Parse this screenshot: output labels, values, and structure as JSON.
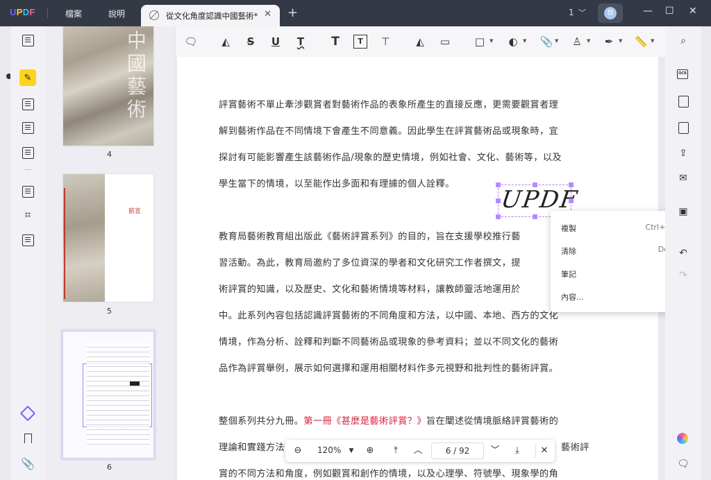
{
  "app": {
    "logo": "UPDF"
  },
  "menu": {
    "file": "檔案",
    "help": "說明"
  },
  "tab": {
    "title": "從文化角度認識中國藝術*",
    "close": "✕",
    "add": "+"
  },
  "window": {
    "page_selector": "1",
    "chevron": "⌄",
    "avatar_initial": "台"
  },
  "thumbnails": [
    {
      "page": "4"
    },
    {
      "page": "5",
      "heading": "前言"
    },
    {
      "page": "6"
    }
  ],
  "thumb4": {
    "title_chars": "中國藝術"
  },
  "document": {
    "lines": [
      "評賞藝術不單止牽涉觀賞者對藝術作品的表象所產生的直接反應，更需要觀賞者理",
      "解到藝術作品在不同情境下會產生不同意義。因此學生在評賞藝術品或現象時，宜",
      "探討有可能影響產生該藝術作品/現象的歷史情境，例如社會、文化、藝術等，以及",
      "學生當下的情境，以至能作出多面和有理據的個人詮釋。",
      "教育局藝術教育組出版此《藝術評賞系列》的目的，旨在支援學校推行藝",
      "習活動。為此，教育局邀約了多位資深的學者和文化研究工作者撰文，提",
      "術評賞的知識，以及歷史、文化和藝術情境等材料，讓教師靈活地運用於",
      "中。此系列內容包括認識評賞藝術的不同角度和方法，以中國、本地、西方的文化",
      "情境，作為分析、詮釋和判斷不同藝術品或現象的參考資料；並以不同文化的藝術",
      "品作為評賞舉例，展示如何選擇和運用相關材料作多元視野和批判性的藝術評賞。"
    ],
    "para3_prefix": "整個系列共分九冊。",
    "para3_red": "第一冊《甚麼是藝術評賞？》",
    "para3_suffix": "旨在闡述從情境脈絡評賞藝術的",
    "para3_line2_left": "理論和實踐方法",
    "para3_line2_right": "藝術評",
    "para3_line3": "賞的不同方法和角度，例如觀賞和創作的情境，以及心理學、符號學、現象學的角",
    "signature": "UPDF"
  },
  "context_menu": {
    "items": [
      {
        "label": "複製",
        "shortcut": "Ctrl+C"
      },
      {
        "label": "清除",
        "shortcut": "Del"
      },
      {
        "label": "筆記",
        "shortcut": ""
      },
      {
        "label": "內容...",
        "shortcut": ""
      }
    ]
  },
  "pagenav": {
    "zoom": "120%",
    "page": "6",
    "total": "92",
    "separator": "/"
  },
  "colors": {
    "titlebar": "#343a45",
    "accent": "#7b5cff",
    "highlight": "#ffd21f",
    "red_text": "#d8233a"
  }
}
